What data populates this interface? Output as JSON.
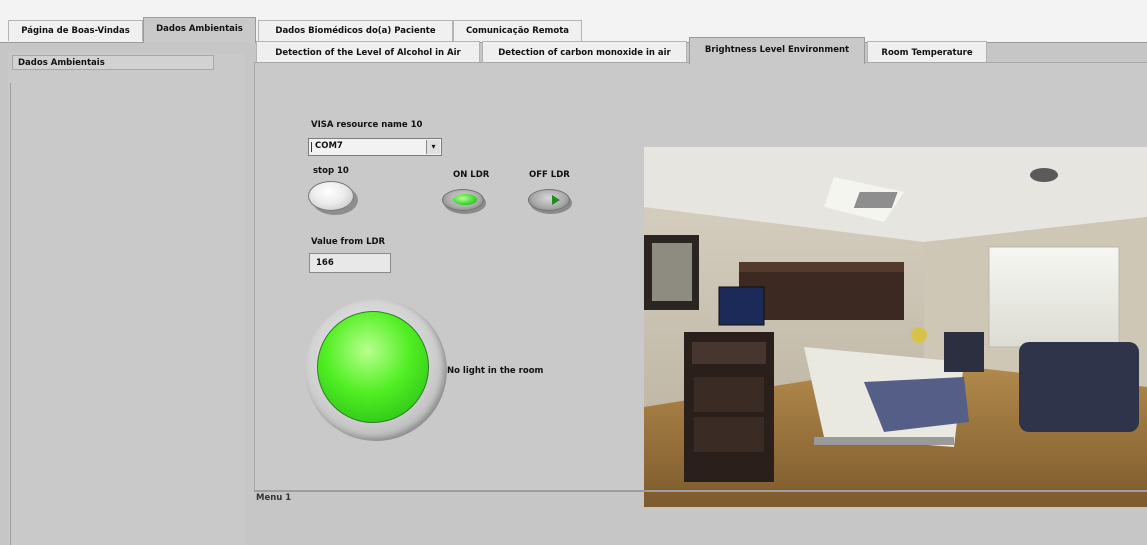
{
  "top_tabs": [
    {
      "label": "Página de Boas-Vindas"
    },
    {
      "label": "Dados Ambientais",
      "active": true
    },
    {
      "label": "Dados Biomédicos do(a) Paciente"
    },
    {
      "label": "Comunicação Remota"
    }
  ],
  "left_panel": {
    "title": "Dados Ambientais"
  },
  "inner_tabs": [
    {
      "label": "Detection of the Level of Alcohol in Air"
    },
    {
      "label": "Detection of carbon monoxide in air"
    },
    {
      "label": "Brightness Level Environment",
      "active": true
    },
    {
      "label": "Room Temperature"
    }
  ],
  "controls": {
    "visa_label": "VISA resource name 10",
    "visa_value": "COM7",
    "stop_label": "stop 10",
    "on_label": "ON LDR",
    "off_label": "OFF LDR",
    "value_label": "Value from LDR",
    "value": "166"
  },
  "indicator": {
    "message": "No light in the room",
    "color": "#3be21a"
  },
  "bottom": {
    "label": "Menu 1"
  },
  "colors": {
    "panel": "#c6c6c6",
    "tab_bg": "#efefef"
  }
}
